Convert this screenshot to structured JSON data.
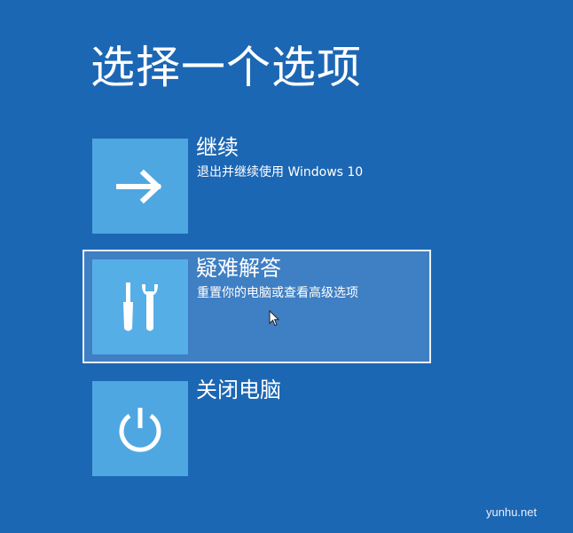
{
  "page": {
    "title": "选择一个选项"
  },
  "options": [
    {
      "label": "继续",
      "description": "退出并继续使用 Windows 10",
      "icon": "arrow-right-icon",
      "selected": false
    },
    {
      "label": "疑难解答",
      "description": "重置你的电脑或查看高级选项",
      "icon": "tools-icon",
      "selected": true
    },
    {
      "label": "关闭电脑",
      "description": "",
      "icon": "power-icon",
      "selected": false
    }
  ],
  "watermark": "yunhu.net",
  "colors": {
    "background": "#1c67b4",
    "tile": "#4ea7e1",
    "selected_background": "#3f7fc3",
    "selected_border": "#e9f1fb",
    "text": "#ffffff"
  }
}
